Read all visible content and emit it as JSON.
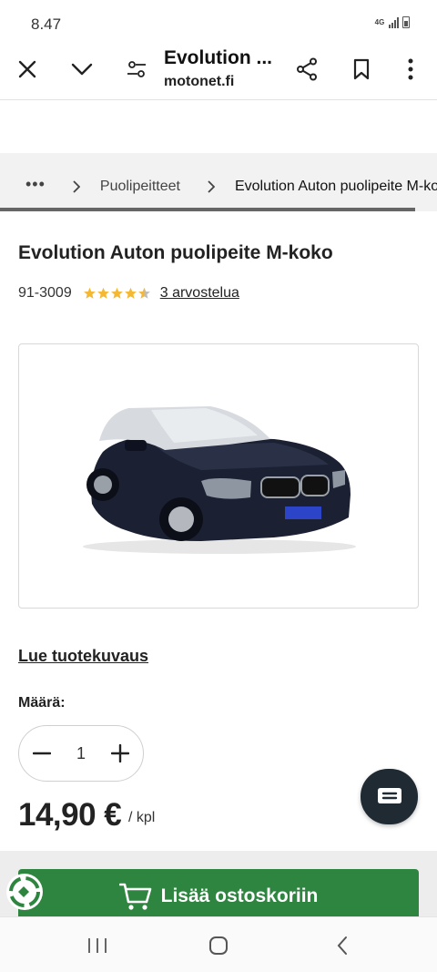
{
  "status_bar": {
    "time": "8.47",
    "network": "4G",
    "icons": [
      "network-icon",
      "signal-icon",
      "battery-icon"
    ]
  },
  "browser": {
    "title": "Evolution ...",
    "domain": "motonet.fi",
    "icons": [
      "close-icon",
      "chevron-down-icon",
      "settings-icon",
      "share-icon",
      "bookmark-icon",
      "more-icon"
    ]
  },
  "breadcrumb": {
    "items": [
      "Puolipeitteet",
      "Evolution Auton puolipeite M-koko"
    ]
  },
  "product": {
    "title": "Evolution Auton puolipeite M-koko",
    "sku": "91-3009",
    "rating": 4.5,
    "rating_max": 5,
    "reviews_label": "3 arvostelua",
    "description_link": "Lue tuotekuvaus",
    "quantity_label": "Määrä:",
    "quantity": "1",
    "price": "14,90 €",
    "unit": "/ kpl",
    "add_to_cart": "Lisää ostoskoriin"
  },
  "colors": {
    "accent_green": "#2e8540",
    "star_gold": "#f5b833",
    "chat_fab": "#1f2a33"
  },
  "nav": {
    "icons": [
      "recents-icon",
      "home-icon",
      "back-icon"
    ]
  }
}
